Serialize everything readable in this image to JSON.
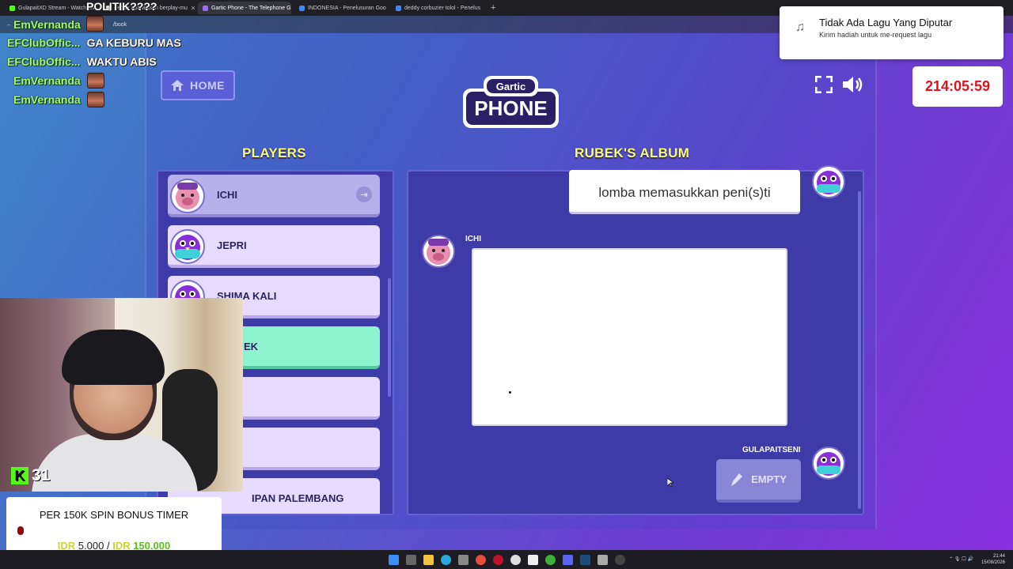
{
  "browser": {
    "tabs": [
      {
        "label": "GulapaitXD Stream - Watch Liv",
        "active": false
      },
      {
        "label": "Tebak apa alasan berplay-mu",
        "active": false
      },
      {
        "label": "Gartic Phone - The Telephone G",
        "active": true
      },
      {
        "label": "INDONESIA - Penelusuran Goo",
        "active": false
      },
      {
        "label": "deddy corbuzier tolol - Penelus",
        "active": false
      }
    ],
    "new_tab": "+",
    "address": "/book"
  },
  "chat": [
    {
      "user": "EmVernanda",
      "message": "POLITIK????",
      "emote": true
    },
    {
      "user": "EFClubOffic...",
      "message": "GA KEBURU MAS",
      "emote": false
    },
    {
      "user": "EFClubOffic...",
      "message": "WAKTU ABIS",
      "emote": false
    },
    {
      "user": "EmVernanda",
      "message": "",
      "emote": true
    },
    {
      "user": "EmVernanda",
      "message": "",
      "emote": true
    }
  ],
  "music": {
    "title": "Tidak Ada Lagu Yang Diputar",
    "subtitle": "Kirim hadiah untuk me-request lagu",
    "icon": "music-note-icon"
  },
  "timer": "214:05:59",
  "game": {
    "home_label": "HOME",
    "logo_top": "Gartic",
    "logo_bottom": "PHONE",
    "players_title": "PLAYERS",
    "album_title": "RUBEK'S ALBUM",
    "players": [
      {
        "name": "ICHI",
        "state": "dim",
        "avatar": "pig"
      },
      {
        "name": "JEPRI",
        "state": "normal",
        "avatar": "bird"
      },
      {
        "name": "SHIMA KALI",
        "state": "normal",
        "avatar": "bird"
      },
      {
        "name": "EK",
        "state": "active",
        "avatar": "none"
      },
      {
        "name": "",
        "state": "normal",
        "avatar": "none"
      },
      {
        "name": "",
        "state": "normal",
        "avatar": "none"
      },
      {
        "name": "IPAN PALEMBANG",
        "state": "normal",
        "avatar": "pig"
      }
    ],
    "album": {
      "prompt_text": "lomba memasukkan peni(s)ti",
      "drawing_author": "ICHI",
      "next_author": "GULAPAITSENI",
      "empty_label": "EMPTY"
    }
  },
  "stream": {
    "kick_count": "31",
    "donation_title": "PER 150K SPIN BONUS TIMER",
    "currency": "IDR",
    "current_amount": "5.000",
    "separator": "/",
    "goal_amount": "150.000"
  },
  "system": {
    "time": "21:44",
    "date": "15/08/2026"
  },
  "colors": {
    "accent_yellow": "#f4ff70",
    "active_player": "#8ef3cf",
    "timer_red": "#e0121c"
  }
}
